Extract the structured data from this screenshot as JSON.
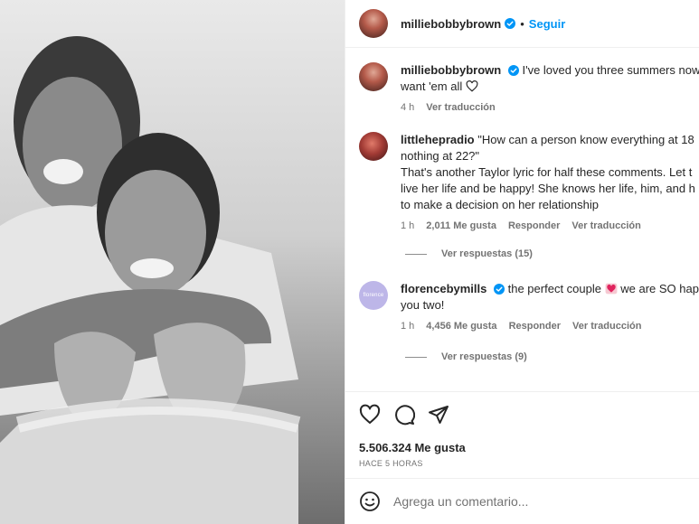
{
  "header": {
    "username": "milliebobbybrown",
    "separator": "•",
    "follow_label": "Seguir"
  },
  "comments": [
    {
      "username": "milliebobbybrown",
      "text_line1": "I've loved you three summers now",
      "text_line2": "want 'em all",
      "time": "4 h",
      "translate": "Ver traducción"
    },
    {
      "username": "littlehepradio",
      "text_line1": "\"How can a person know everything at 18",
      "text_line2": "nothing at 22?\"",
      "text_line3": "That's another Taylor lyric for half these comments. Let t",
      "text_line4": "live her life and be happy! She knows her life, him, and h",
      "text_line5": "to make a decision on her relationship",
      "time": "1 h",
      "likes": "2,011 Me gusta",
      "reply": "Responder",
      "translate": "Ver traducción",
      "view_replies": "Ver respuestas (15)"
    },
    {
      "username": "florencebymills",
      "avatar_text": "florence",
      "text_line1": "the perfect couple",
      "text_line1b": "we are SO hap",
      "text_line2": "you two!",
      "time": "1 h",
      "likes": "4,456 Me gusta",
      "reply": "Responder",
      "translate": "Ver traducción",
      "view_replies": "Ver respuestas (9)"
    }
  ],
  "actions": {
    "likes": "5.506.324 Me gusta",
    "time": "HACE 5 HORAS"
  },
  "composer": {
    "placeholder": "Agrega un comentario..."
  },
  "colors": {
    "accent": "#0095f6",
    "verified": "#0095f6",
    "meta_text": "#737373"
  }
}
